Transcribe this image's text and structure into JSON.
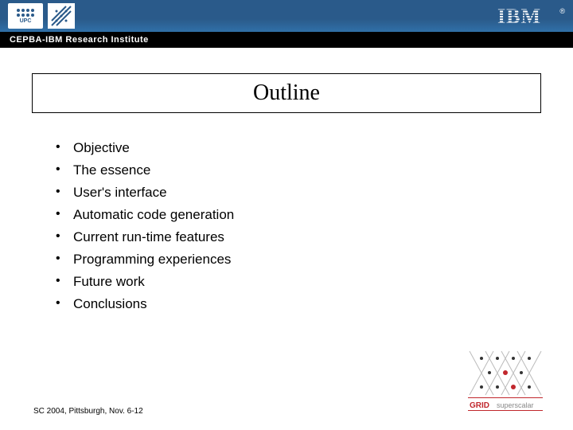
{
  "header": {
    "institute_label": "CEPBA-IBM Research Institute",
    "upc_label": "UPC",
    "ibm_label": "IBM",
    "registered": "®"
  },
  "title": "Outline",
  "bullets": [
    "Objective",
    "The essence",
    "User's interface",
    "Automatic code generation",
    "Current run-time features",
    "Programming experiences",
    "Future work",
    "Conclusions"
  ],
  "footer": "SC 2004, Pittsburgh, Nov. 6-12",
  "grid_logo": {
    "line1": "GRID",
    "line2": "superscalar"
  }
}
